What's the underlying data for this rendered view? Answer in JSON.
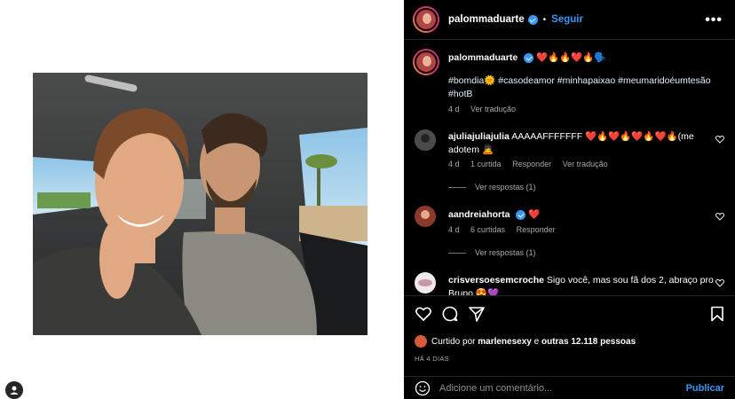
{
  "post": {
    "author": "palommaduarte",
    "follow_label": "Seguir",
    "separator": "•",
    "more_label": "•••"
  },
  "caption": {
    "author": "palommaduarte",
    "emojis": "❤️🔥🔥❤️🔥🗣️",
    "hashtags_line1": "#bomdia🌞 #casodeamor #minhapaixao #meumaridoéumtesão",
    "hashtags_line2": "#hotB",
    "time": "4 d",
    "translate": "Ver tradução"
  },
  "comments": [
    {
      "author": "ajuliajuliajulia",
      "text": "AAAAAFFFFFFF ❤️🔥❤️🔥❤️🔥❤️🔥(me",
      "text_line2": "adotem 🙇",
      "time": "4 d",
      "likes": "1 curtida",
      "reply": "Responder",
      "translate": "Ver tradução",
      "view_replies": "Ver respostas (1)"
    },
    {
      "author": "aandreiahorta",
      "text": "❤️",
      "time": "4 d",
      "likes": "6 curtidas",
      "reply": "Responder",
      "view_replies": "Ver respostas (1)"
    },
    {
      "author": "crisversoesemcroche",
      "text": "Sigo você, mas sou fã dos 2, abraço pro",
      "text_line2": "Bruno 😍💜"
    }
  ],
  "liked": {
    "prefix": "Curtido por",
    "user": "marlenesexy",
    "middle": "e",
    "others": "outras 12.118 pessoas"
  },
  "timestamp": "HÁ 4 DIAS",
  "add_comment": {
    "placeholder": "Adicione um comentário...",
    "publish": "Publicar"
  },
  "colors": {
    "accent": "#3897f0",
    "background": "#000000",
    "muted": "#a8a8a8"
  }
}
